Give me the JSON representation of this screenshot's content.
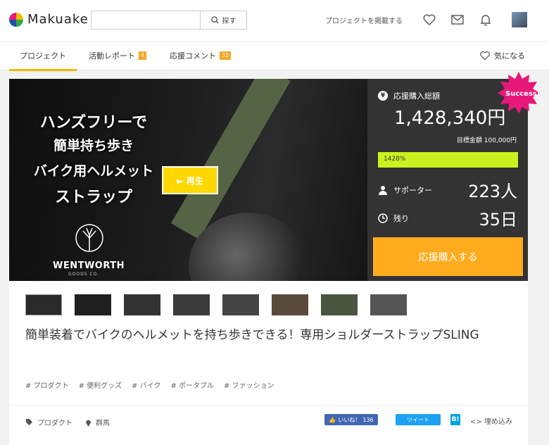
{
  "header": {
    "logo_text": "Makuake",
    "search_placeholder": "",
    "search_button": "探す",
    "post_project": "プロジェクトを掲載する"
  },
  "tabs": [
    {
      "label": "プロジェクト"
    },
    {
      "label": "活動レポート",
      "badge": "4"
    },
    {
      "label": "応援コメント",
      "badge": "35"
    }
  ],
  "favorite_label": "気になる",
  "hero": {
    "lines": [
      "ハンズフリーで",
      "簡単持ち歩き",
      "バイク用ヘルメット",
      "ストラップ"
    ],
    "play_label": "► 再生",
    "brand": "WENTWORTH",
    "brand_sub": "GOODS CO."
  },
  "stats": {
    "total_label": "応援購入総額",
    "total_value": "1,428,340円",
    "goal": "目標金額 100,000円",
    "progress_text": "1428%",
    "progress_fraction": 1.0,
    "supporters_label": "サポーター",
    "supporters_value": "223人",
    "remaining_label": "残り",
    "remaining_value": "35日",
    "buy_label": "応援購入する",
    "success_label": "Success!"
  },
  "title": "簡単装着でバイクのヘルメットを持ち歩きできる！専用ショルダーストラップSLING",
  "tags": [
    "# プロダクト",
    "# 便利グッズ",
    "# バイク",
    "# ポータブル",
    "# ファッション"
  ],
  "meta": {
    "category": "プロダクト",
    "location": "群馬"
  },
  "share": {
    "like": "いいね！",
    "like_count": "136",
    "tweet": "ツイート",
    "hatena": "B!",
    "embed": "<> 埋め込み"
  },
  "colors": {
    "accent_yellow": "#f5b800",
    "buy_orange": "#ffab1e",
    "progress_green": "#c9f21f",
    "success_pink": "#e8187a"
  }
}
